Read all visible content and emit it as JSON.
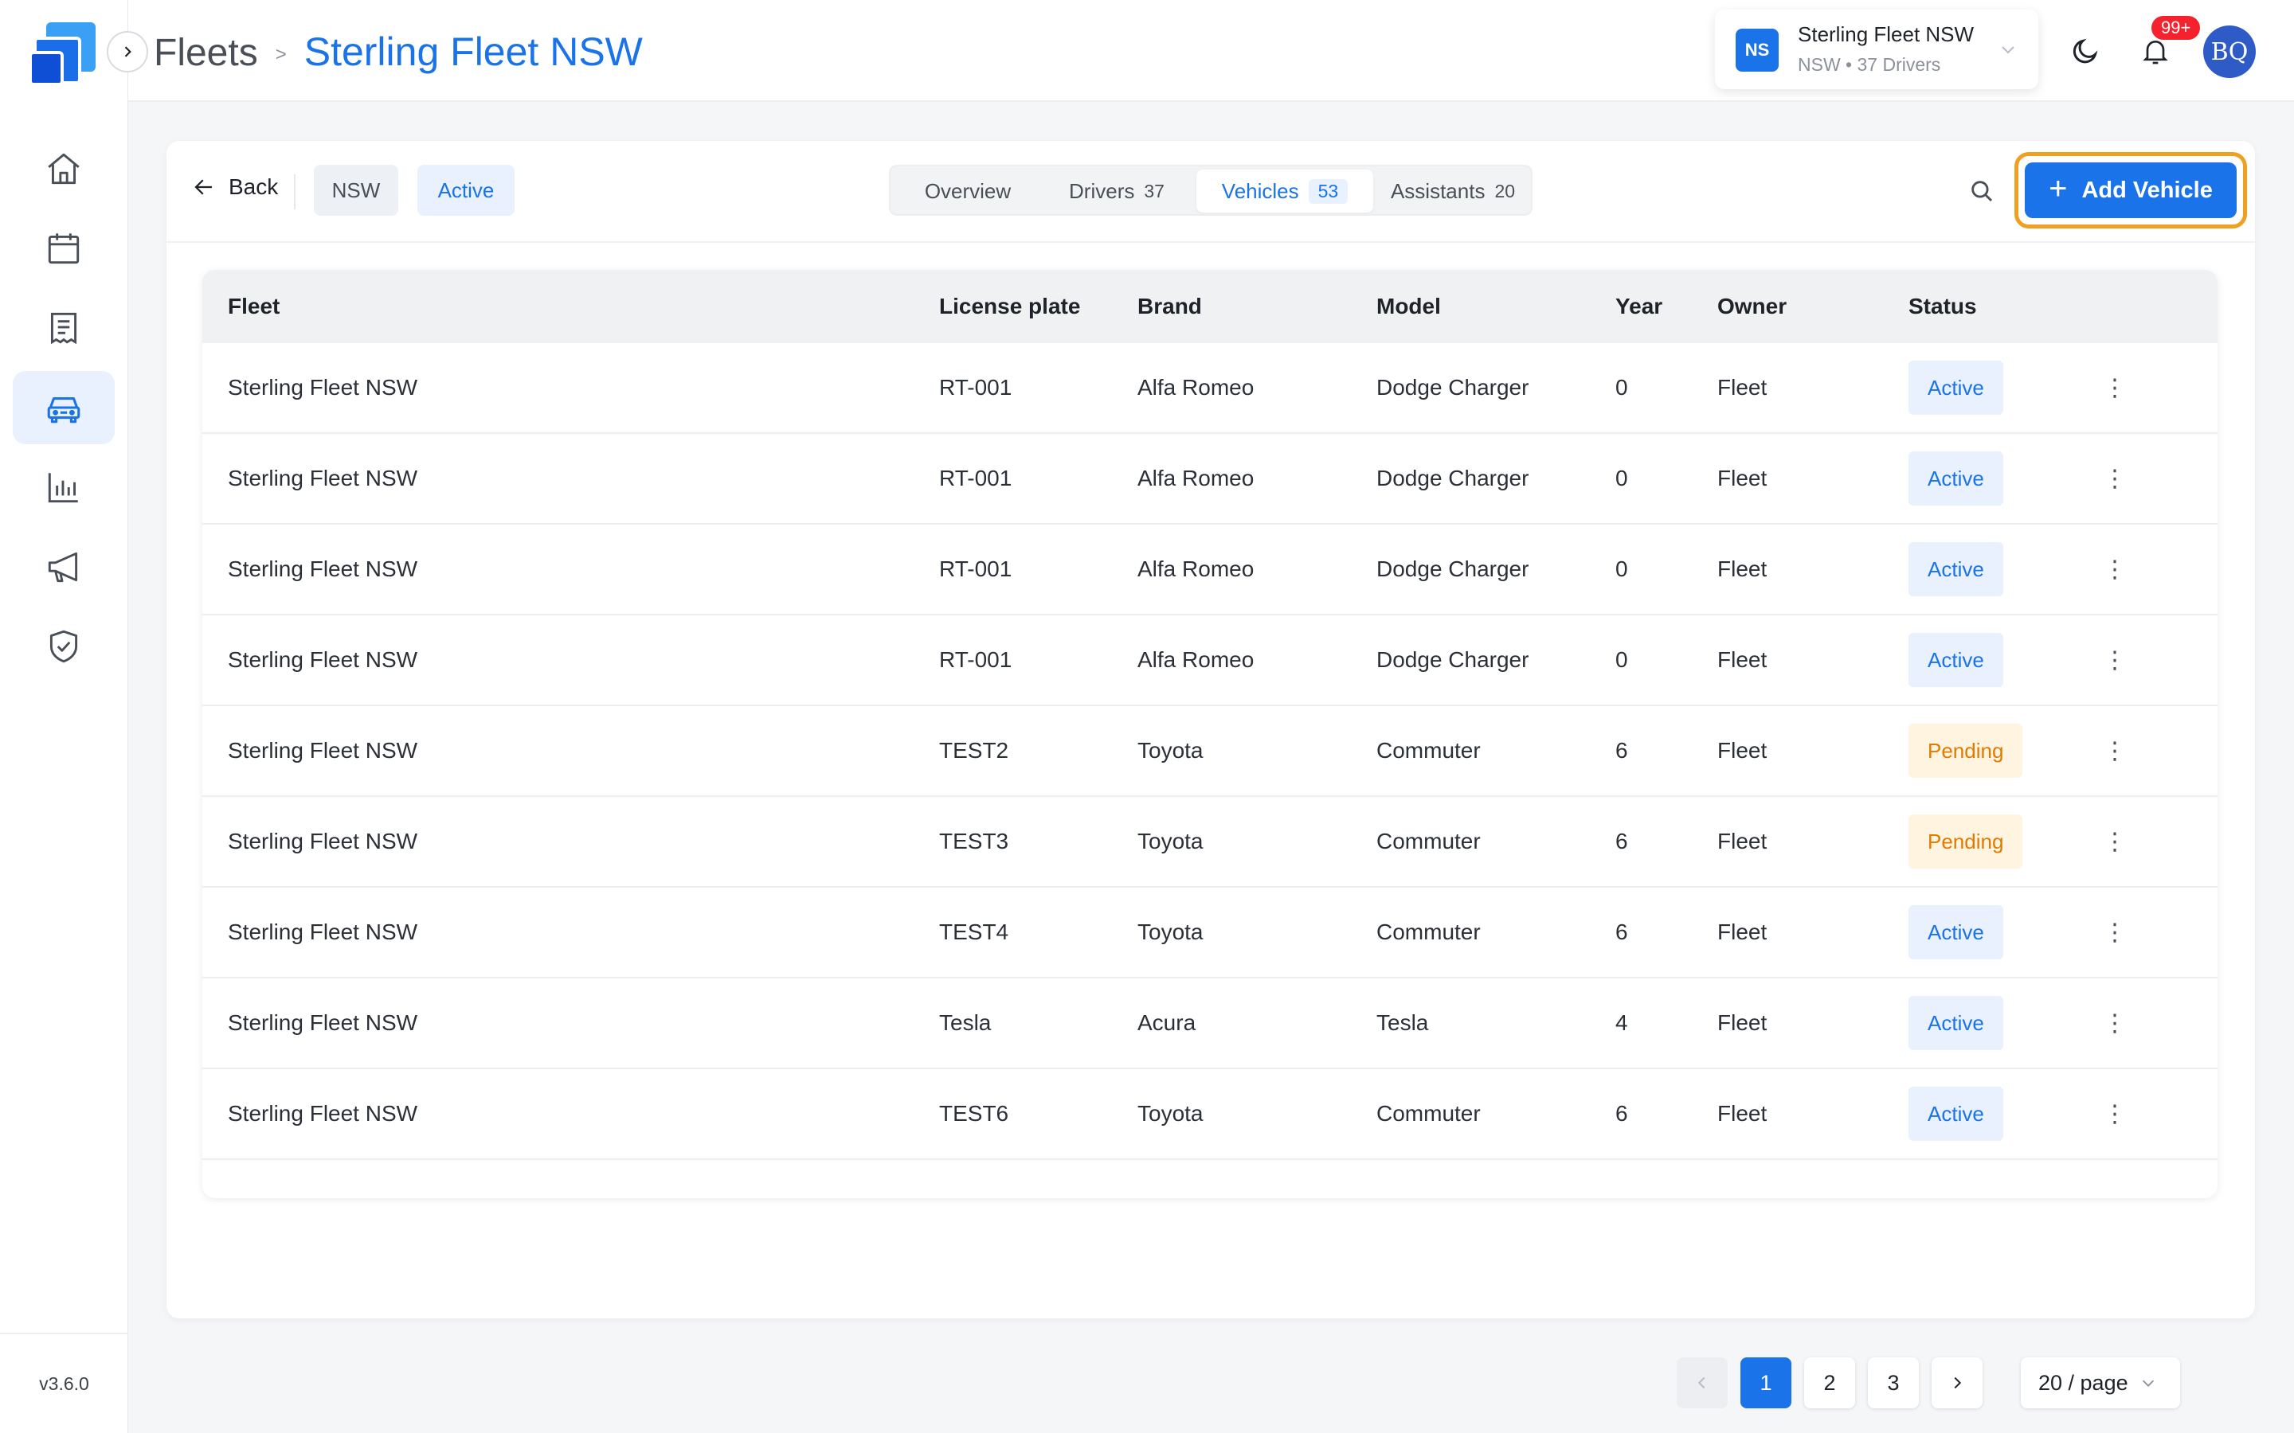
{
  "app": {
    "version": "v3.6.0"
  },
  "breadcrumb": {
    "root": "Fleets",
    "separator": ">",
    "current": "Sterling Fleet NSW"
  },
  "fleet_switcher": {
    "initials": "NS",
    "name": "Sterling Fleet NSW",
    "subtitle": "NSW • 37 Drivers"
  },
  "notifications": {
    "badge": "99+"
  },
  "user": {
    "initials": "BQ"
  },
  "sidebar": {
    "items": [
      {
        "name": "home-icon",
        "active": false
      },
      {
        "name": "calendar-icon",
        "active": false
      },
      {
        "name": "document-icon",
        "active": false
      },
      {
        "name": "car-icon",
        "active": true
      },
      {
        "name": "bar-chart-icon",
        "active": false
      },
      {
        "name": "megaphone-icon",
        "active": false
      },
      {
        "name": "shield-check-icon",
        "active": false
      }
    ]
  },
  "toolbar": {
    "back_label": "Back",
    "region_chip": "NSW",
    "status_chip": "Active",
    "tabs": [
      {
        "label": "Overview",
        "count": ""
      },
      {
        "label": "Drivers",
        "count": "37"
      },
      {
        "label": "Vehicles",
        "count": "53"
      },
      {
        "label": "Assistants",
        "count": "20"
      }
    ],
    "active_tab": "Vehicles",
    "add_button": "Add Vehicle"
  },
  "table": {
    "columns": [
      "Fleet",
      "License plate",
      "Brand",
      "Model",
      "Year",
      "Owner",
      "Status"
    ],
    "rows": [
      {
        "fleet": "Sterling Fleet NSW",
        "plate": "RT-001",
        "brand": "Alfa Romeo",
        "model": "Dodge Charger",
        "year": "0",
        "owner": "Fleet",
        "status": "Active"
      },
      {
        "fleet": "Sterling Fleet NSW",
        "plate": "RT-001",
        "brand": "Alfa Romeo",
        "model": "Dodge Charger",
        "year": "0",
        "owner": "Fleet",
        "status": "Active"
      },
      {
        "fleet": "Sterling Fleet NSW",
        "plate": "RT-001",
        "brand": "Alfa Romeo",
        "model": "Dodge Charger",
        "year": "0",
        "owner": "Fleet",
        "status": "Active"
      },
      {
        "fleet": "Sterling Fleet NSW",
        "plate": "RT-001",
        "brand": "Alfa Romeo",
        "model": "Dodge Charger",
        "year": "0",
        "owner": "Fleet",
        "status": "Active"
      },
      {
        "fleet": "Sterling Fleet NSW",
        "plate": "TEST2",
        "brand": "Toyota",
        "model": "Commuter",
        "year": "6",
        "owner": "Fleet",
        "status": "Pending"
      },
      {
        "fleet": "Sterling Fleet NSW",
        "plate": "TEST3",
        "brand": "Toyota",
        "model": "Commuter",
        "year": "6",
        "owner": "Fleet",
        "status": "Pending"
      },
      {
        "fleet": "Sterling Fleet NSW",
        "plate": "TEST4",
        "brand": "Toyota",
        "model": "Commuter",
        "year": "6",
        "owner": "Fleet",
        "status": "Active"
      },
      {
        "fleet": "Sterling Fleet NSW",
        "plate": "Tesla",
        "brand": "Acura",
        "model": "Tesla",
        "year": "4",
        "owner": "Fleet",
        "status": "Active"
      },
      {
        "fleet": "Sterling Fleet NSW",
        "plate": "TEST6",
        "brand": "Toyota",
        "model": "Commuter",
        "year": "6",
        "owner": "Fleet",
        "status": "Active"
      }
    ],
    "row_menu_glyph": "⋮"
  },
  "pagination": {
    "pages": [
      "1",
      "2",
      "3"
    ],
    "current": "1",
    "page_size": "20 / page"
  },
  "colors": {
    "accent": "#1a73e8",
    "highlight_outline": "#f0a020",
    "pending": "#e07b00",
    "badge": "#f5222d"
  }
}
